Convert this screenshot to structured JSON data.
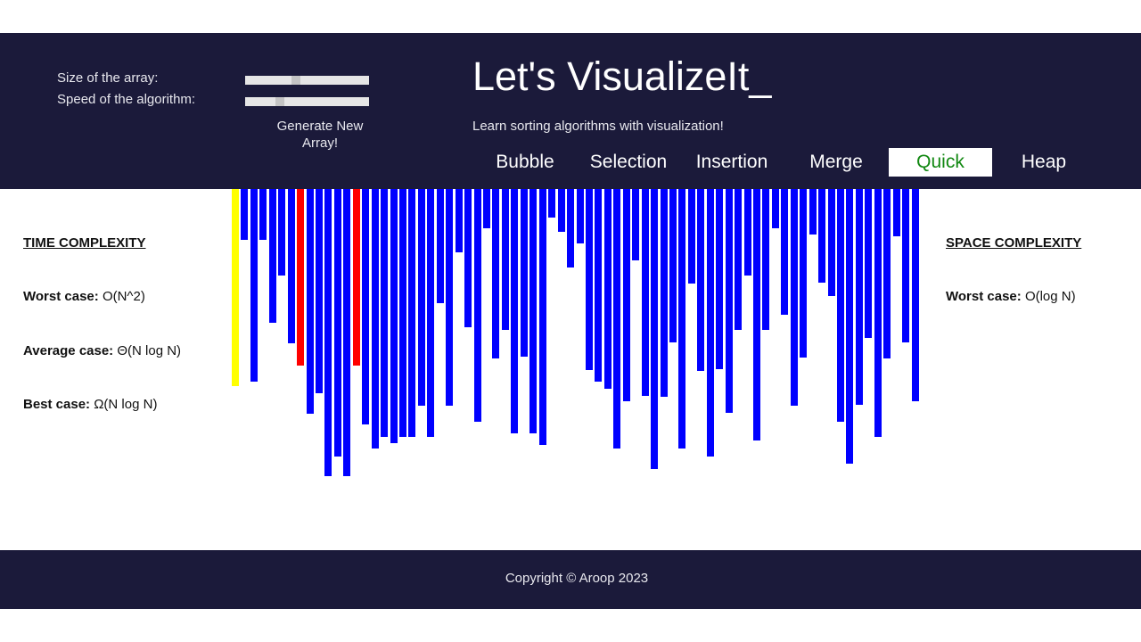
{
  "header": {
    "size_label": "Size of the array:",
    "speed_label": "Speed of the algorithm:",
    "size_slider_value": 0.4,
    "speed_slider_value": 0.26,
    "generate_button": "Generate New Array!",
    "title": "Let's VisualizeIt_",
    "subtitle": "Learn sorting algorithms with visualization!"
  },
  "algorithms": [
    {
      "label": "Bubble",
      "active": false
    },
    {
      "label": "Selection",
      "active": false
    },
    {
      "label": "Insertion",
      "active": false
    },
    {
      "label": "Merge",
      "active": false
    },
    {
      "label": "Quick",
      "active": true
    },
    {
      "label": "Heap",
      "active": false
    }
  ],
  "time_complexity": {
    "heading": "TIME COMPLEXITY",
    "worst_label": "Worst case:",
    "worst_value": "O(N^2)",
    "average_label": "Average case:",
    "average_value": "Θ(N log N)",
    "best_label": "Best case:",
    "best_value": "Ω(N log N)"
  },
  "space_complexity": {
    "heading": "SPACE COMPLEXITY",
    "worst_label": "Worst case:",
    "worst_value": "O(log N)"
  },
  "colors": {
    "header_bg": "#1b1a3a",
    "bar_default": "#0000ff",
    "bar_pivot": "#ffff00",
    "bar_compare": "#ff0000",
    "active_tab_text": "#118811"
  },
  "array": {
    "max_value": 404,
    "values": [
      221,
      57,
      216,
      57,
      150,
      97,
      173,
      198,
      252,
      229,
      322,
      300,
      322,
      198,
      264,
      291,
      278,
      285,
      278,
      278,
      243,
      278,
      128,
      243,
      71,
      155,
      261,
      44,
      190,
      158,
      274,
      188,
      274,
      287,
      32,
      48,
      88,
      61,
      203,
      216,
      224,
      291,
      238,
      80,
      232,
      314,
      233,
      172,
      291,
      106,
      204,
      300,
      202,
      251,
      158,
      97,
      282,
      158,
      44,
      141,
      243,
      189,
      51,
      105,
      120,
      261,
      308,
      242,
      167,
      278,
      190,
      53,
      172,
      238
    ],
    "highlight": {
      "0": "pivot",
      "7": "compare",
      "13": "compare"
    }
  },
  "footer": {
    "copyright": "Copyright © Aroop 2023"
  }
}
